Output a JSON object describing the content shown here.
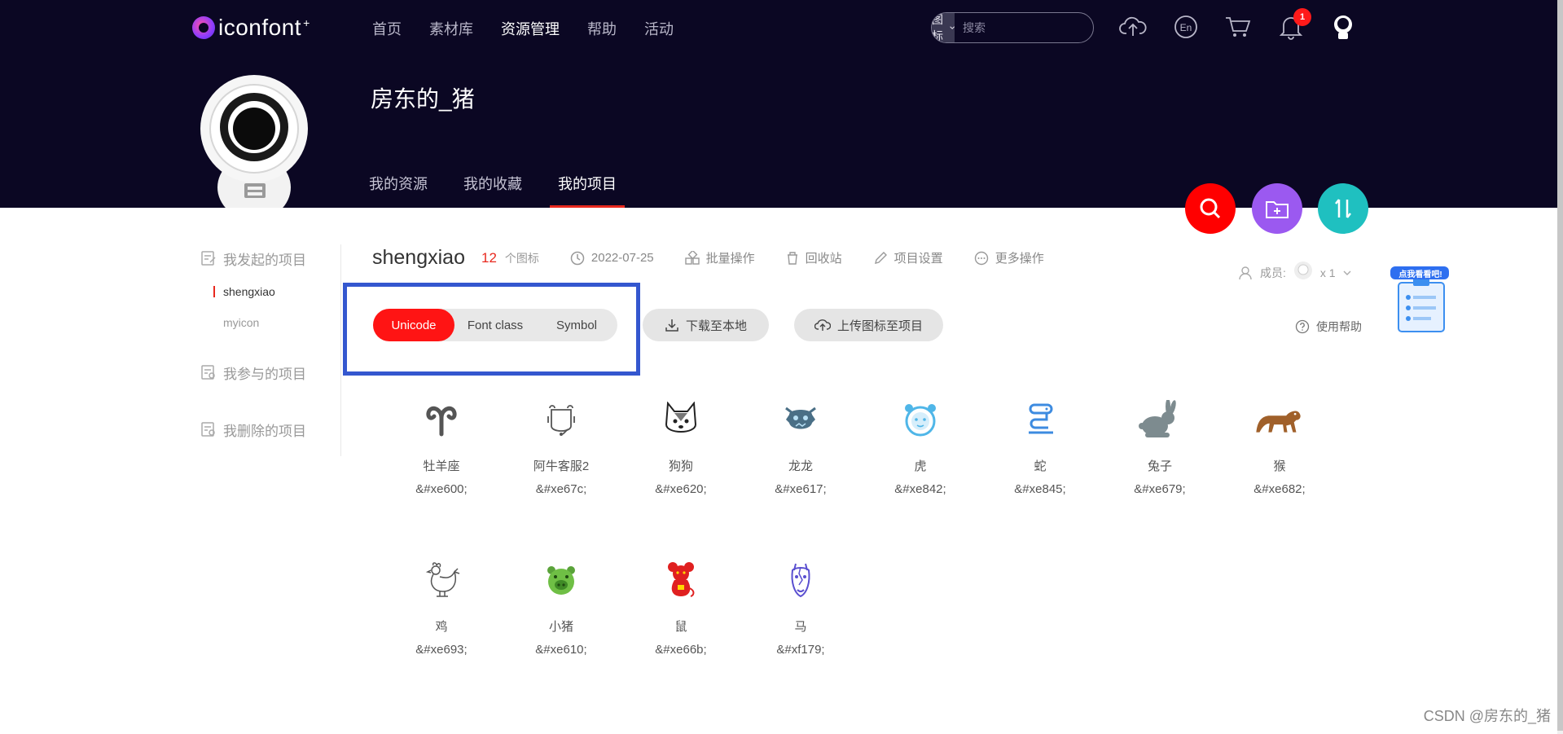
{
  "header": {
    "logo_text": "iconfont",
    "logo_plus": "+",
    "nav": [
      {
        "label": "首页",
        "active": false
      },
      {
        "label": "素材库",
        "active": false
      },
      {
        "label": "资源管理",
        "active": true
      },
      {
        "label": "帮助",
        "active": false
      },
      {
        "label": "活动",
        "active": false
      }
    ],
    "search": {
      "type_label": "图标",
      "placeholder": "搜索"
    },
    "notification_count": "1",
    "lang_label": "En"
  },
  "profile": {
    "username": "房东的_猪",
    "tabs": [
      {
        "label": "我的资源",
        "active": false
      },
      {
        "label": "我的收藏",
        "active": false
      },
      {
        "label": "我的项目",
        "active": true
      }
    ]
  },
  "sidebar": {
    "groups": [
      {
        "label": "我发起的项目",
        "items": [
          {
            "label": "shengxiao",
            "active": true
          },
          {
            "label": "myicon",
            "active": false
          }
        ]
      },
      {
        "label": "我参与的项目",
        "items": []
      },
      {
        "label": "我删除的项目",
        "items": []
      }
    ]
  },
  "project": {
    "name": "shengxiao",
    "count": "12",
    "count_unit": "个图标",
    "date": "2022-07-25",
    "actions": [
      "批量操作",
      "回收站",
      "项目设置",
      "更多操作"
    ],
    "members_label": "成员:",
    "members_count": "x 1"
  },
  "code_tabs": [
    {
      "label": "Unicode",
      "active": true
    },
    {
      "label": "Font class",
      "active": false
    },
    {
      "label": "Symbol",
      "active": false
    }
  ],
  "buttons": {
    "download": "下载至本地",
    "upload": "上传图标至项目",
    "help": "使用帮助",
    "sticker": "点我看看吧!"
  },
  "icons": [
    {
      "name": "牡羊座",
      "code": "&#xe600;",
      "icon": "aries-icon",
      "color": "#555555"
    },
    {
      "name": "阿牛客服2",
      "code": "&#xe67c;",
      "icon": "cow-service-icon",
      "color": "#555555"
    },
    {
      "name": "狗狗",
      "code": "&#xe620;",
      "icon": "dog-icon",
      "color": "#333333"
    },
    {
      "name": "龙龙",
      "code": "&#xe617;",
      "icon": "dragon-icon",
      "color": "#4a6f86"
    },
    {
      "name": "虎",
      "code": "&#xe842;",
      "icon": "tiger-icon",
      "color": "#4fb6e8"
    },
    {
      "name": "蛇",
      "code": "&#xe845;",
      "icon": "snake-icon",
      "color": "#3d8be0"
    },
    {
      "name": "兔子",
      "code": "&#xe679;",
      "icon": "rabbit-icon",
      "color": "#7d8b8f"
    },
    {
      "name": "猴",
      "code": "&#xe682;",
      "icon": "monkey-icon",
      "color": "#a0602a"
    },
    {
      "name": "鸡",
      "code": "&#xe693;",
      "icon": "rooster-icon",
      "color": "#555555"
    },
    {
      "name": "小猪",
      "code": "&#xe610;",
      "icon": "pig-icon",
      "color": "#5aa33a"
    },
    {
      "name": "鼠",
      "code": "&#xe66b;",
      "icon": "rat-icon",
      "color": "#e02020"
    },
    {
      "name": "马",
      "code": "&#xf179;",
      "icon": "horse-icon",
      "color": "#5a4fd0"
    }
  ],
  "colors": {
    "header_bg": "#0b0723",
    "accent_red": "#ff1414",
    "highlight_box": "#3457cf",
    "fab_search": "#ff0000",
    "fab_folder": "#9b59f0",
    "fab_sort": "#1fc0c0"
  },
  "watermark": "CSDN @房东的_猪"
}
